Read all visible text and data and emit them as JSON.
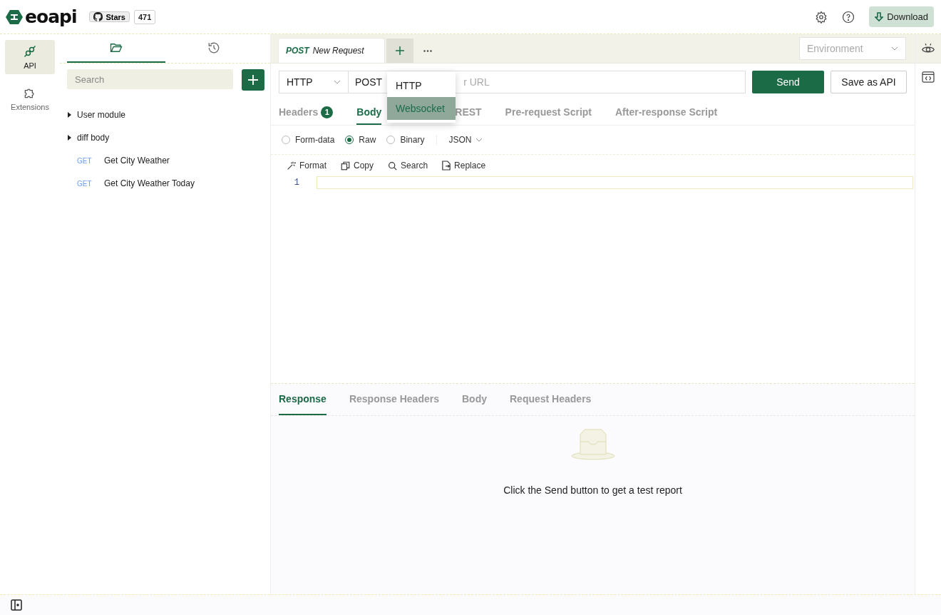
{
  "header": {
    "logo": "eoapi",
    "stars_label": "Stars",
    "stars_count": "471",
    "download": "Download"
  },
  "nav_rail": [
    {
      "kind": "api",
      "label": "API",
      "selected": true
    },
    {
      "kind": "extensions",
      "label": "Extensions",
      "selected": false
    }
  ],
  "sidebar": {
    "tabs": [
      {
        "kind": "folder",
        "selected": true
      },
      {
        "kind": "history",
        "selected": false
      }
    ],
    "search": {
      "placeholder": "Search"
    },
    "tree": [
      {
        "kind": "group",
        "label": "User module",
        "expanded": false
      },
      {
        "kind": "group",
        "label": "diff body",
        "expanded": false
      },
      {
        "kind": "api",
        "method": "GET",
        "label": "Get City Weather"
      },
      {
        "kind": "api",
        "method": "GET",
        "label": "Get City Weather Today"
      }
    ]
  },
  "request_tabs": [
    {
      "method": "POST",
      "title": "New Request",
      "selected": true
    }
  ],
  "environment": {
    "placeholder": "Environment"
  },
  "request": {
    "protocol": "HTTP",
    "method": "POST",
    "url_placeholder": "r URL",
    "send": "Send",
    "save": "Save as API"
  },
  "protocol_menu": [
    {
      "label": "HTTP",
      "selected": false
    },
    {
      "label": "Websocket",
      "selected": true
    }
  ],
  "body_tabs": [
    {
      "label": "Headers",
      "badge": "1",
      "selected": false
    },
    {
      "label": "Body",
      "selected": true
    },
    {
      "label": "REST",
      "selected": false
    },
    {
      "label": "Pre-request Script",
      "selected": false
    },
    {
      "label": "After-response Script",
      "selected": false
    }
  ],
  "body_types": [
    {
      "label": "Form-data",
      "selected": false
    },
    {
      "label": "Raw",
      "selected": true
    },
    {
      "label": "Binary",
      "selected": false
    }
  ],
  "format": "JSON",
  "editor_tools": [
    {
      "kind": "format",
      "label": "Format"
    },
    {
      "kind": "copy",
      "label": "Copy"
    },
    {
      "kind": "search",
      "label": "Search"
    },
    {
      "kind": "replace",
      "label": "Replace"
    }
  ],
  "line_numbers": [
    "1"
  ],
  "response_tabs": [
    {
      "label": "Response",
      "selected": true
    },
    {
      "label": "Response Headers",
      "selected": false
    },
    {
      "label": "Body",
      "selected": false
    },
    {
      "label": "Request Headers",
      "selected": false
    }
  ],
  "empty_message": "Click the Send button to get a test report"
}
